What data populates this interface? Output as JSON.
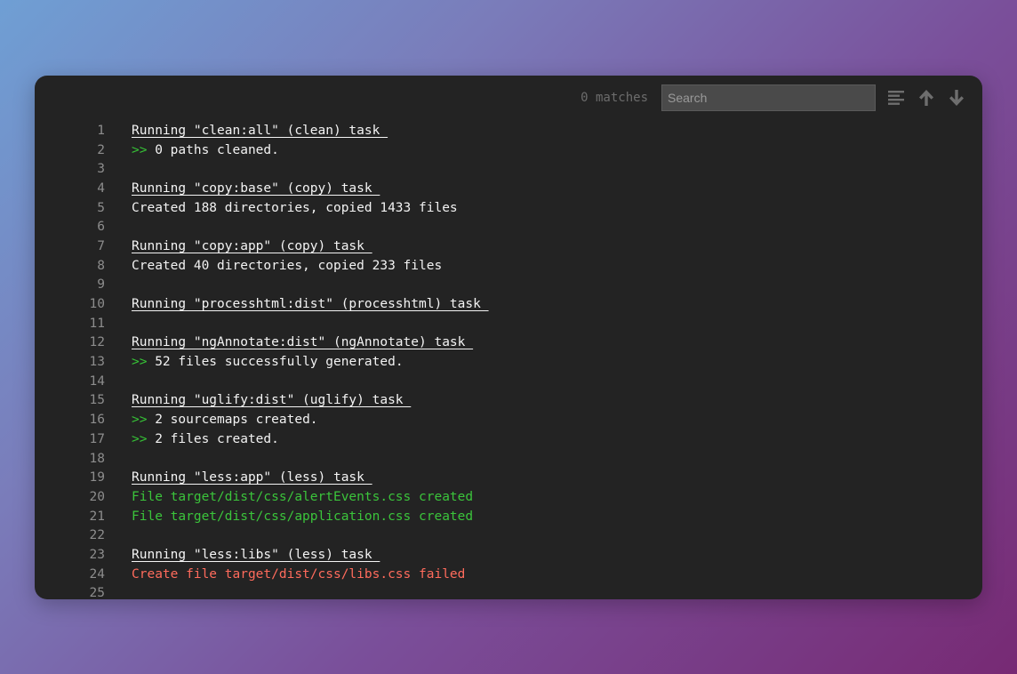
{
  "toolbar": {
    "matches": "0 matches",
    "search_placeholder": "Search",
    "icons": [
      "align-left-icon",
      "arrow-up-icon",
      "arrow-down-icon"
    ]
  },
  "colors": {
    "prompt": "#36c336",
    "success": "#3bc43b",
    "error": "#ff6b5c"
  },
  "lines": [
    {
      "n": "1",
      "text": "Running \"clean:all\" (clean) task ",
      "type": "header"
    },
    {
      "n": "2",
      "prompt": ">>",
      "text": " 0 paths cleaned.",
      "type": "info"
    },
    {
      "n": "3",
      "text": "",
      "type": "blank"
    },
    {
      "n": "4",
      "text": "Running \"copy:base\" (copy) task ",
      "type": "header"
    },
    {
      "n": "5",
      "text": "Created 188 directories, copied 1433 files",
      "type": "plain"
    },
    {
      "n": "6",
      "text": "",
      "type": "blank"
    },
    {
      "n": "7",
      "text": "Running \"copy:app\" (copy) task ",
      "type": "header"
    },
    {
      "n": "8",
      "text": "Created 40 directories, copied 233 files",
      "type": "plain"
    },
    {
      "n": "9",
      "text": "",
      "type": "blank"
    },
    {
      "n": "10",
      "text": "Running \"processhtml:dist\" (processhtml) task ",
      "type": "header"
    },
    {
      "n": "11",
      "text": "",
      "type": "blank"
    },
    {
      "n": "12",
      "text": "Running \"ngAnnotate:dist\" (ngAnnotate) task ",
      "type": "header"
    },
    {
      "n": "13",
      "prompt": ">>",
      "text": " 52 files successfully generated.",
      "type": "info"
    },
    {
      "n": "14",
      "text": "",
      "type": "blank"
    },
    {
      "n": "15",
      "text": "Running \"uglify:dist\" (uglify) task ",
      "type": "header"
    },
    {
      "n": "16",
      "prompt": ">>",
      "text": " 2 sourcemaps created.",
      "type": "info"
    },
    {
      "n": "17",
      "prompt": ">>",
      "text": " 2 files created.",
      "type": "info"
    },
    {
      "n": "18",
      "text": "",
      "type": "blank"
    },
    {
      "n": "19",
      "text": "Running \"less:app\" (less) task ",
      "type": "header"
    },
    {
      "n": "20",
      "text": "File target/dist/css/alertEvents.css created",
      "type": "success"
    },
    {
      "n": "21",
      "text": "File target/dist/css/application.css created",
      "type": "success"
    },
    {
      "n": "22",
      "text": "",
      "type": "blank"
    },
    {
      "n": "23",
      "text": "Running \"less:libs\" (less) task ",
      "type": "header"
    },
    {
      "n": "24",
      "text": "Create file target/dist/css/libs.css failed",
      "type": "error"
    },
    {
      "n": "25",
      "text": "",
      "type": "blank"
    }
  ]
}
